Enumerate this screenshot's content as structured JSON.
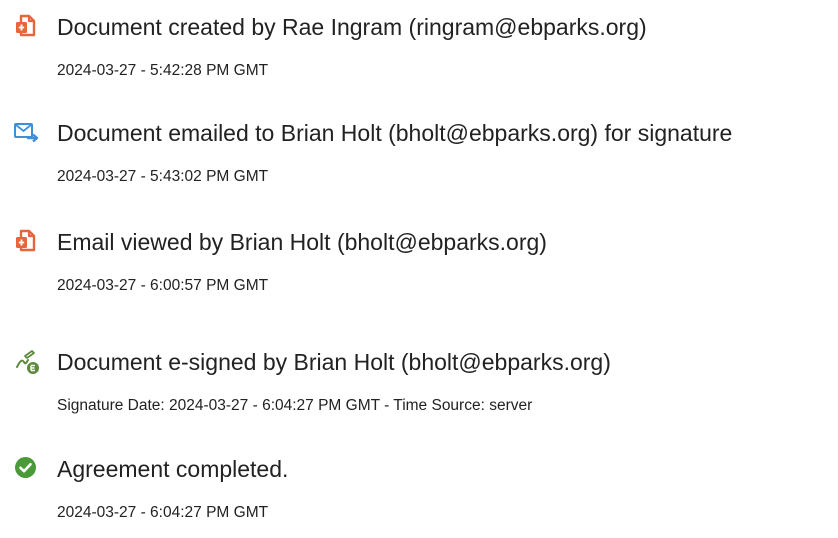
{
  "events": [
    {
      "icon": "document-created-icon",
      "title": "Document created by Rae Ingram (ringram@ebparks.org)",
      "meta": "2024-03-27 - 5:42:28 PM GMT"
    },
    {
      "icon": "email-sent-icon",
      "title": "Document emailed to Brian Holt (bholt@ebparks.org) for signature",
      "meta": "2024-03-27 - 5:43:02 PM GMT"
    },
    {
      "icon": "email-viewed-icon",
      "title": "Email viewed by Brian Holt (bholt@ebparks.org)",
      "meta": "2024-03-27 - 6:00:57 PM GMT"
    },
    {
      "icon": "e-signed-icon",
      "title": "Document e-signed by Brian Holt (bholt@ebparks.org)",
      "meta": "Signature Date: 2024-03-27 - 6:04:27 PM GMT - Time Source: server"
    },
    {
      "icon": "checkmark-icon",
      "title": "Agreement completed.",
      "meta": "2024-03-27 - 6:04:27 PM GMT"
    }
  ],
  "colors": {
    "document_icon": "#e8653a",
    "email_icon": "#3f8fd8",
    "sign_icon": "#5f8a3e",
    "check_icon": "#4a9a3a"
  }
}
